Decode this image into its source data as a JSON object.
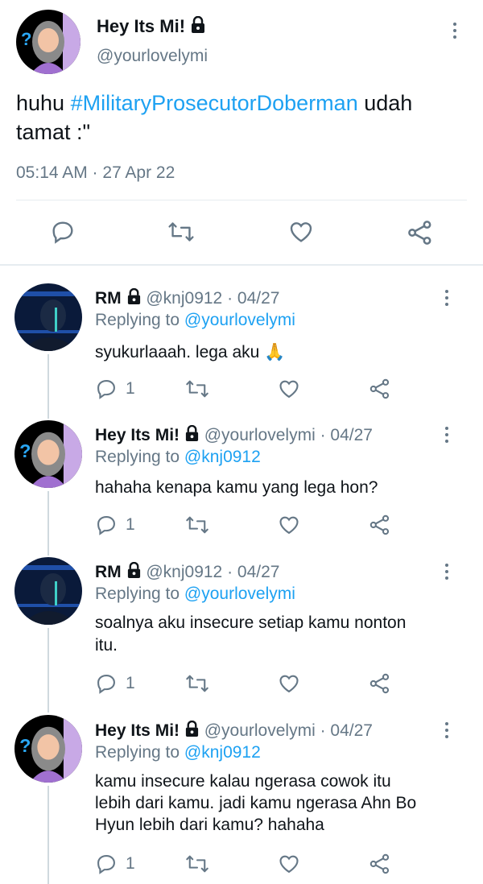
{
  "main_tweet": {
    "author_name": "Hey Its Mi!",
    "handle": "@yourlovelymi",
    "text_before": "huhu ",
    "hashtag": "#MilitaryProsecutorDoberman",
    "text_after_line1": " udah",
    "text_line2": "tamat :\"",
    "timestamp": "05:14 AM · 27 Apr 22"
  },
  "replies": [
    {
      "author_name": "RM",
      "handle": "@knj0912 · 04/27",
      "replying_label": "Replying to ",
      "replying_to": "@yourlovelymi",
      "text_lines": [
        "syukurlaaah. lega aku 🙏"
      ],
      "reply_count": "1",
      "avatar": "rm"
    },
    {
      "author_name": "Hey Its Mi!",
      "handle": "@yourlovelymi · 04/27",
      "replying_label": "Replying to ",
      "replying_to": "@knj0912",
      "text_lines": [
        "hahaha kenapa kamu yang lega hon?"
      ],
      "reply_count": "1",
      "avatar": "mi"
    },
    {
      "author_name": "RM",
      "handle": "@knj0912 · 04/27",
      "replying_label": "Replying to ",
      "replying_to": "@yourlovelymi",
      "text_lines": [
        "soalnya aku insecure setiap kamu nonton",
        "itu."
      ],
      "reply_count": "1",
      "avatar": "rm"
    },
    {
      "author_name": "Hey Its Mi!",
      "handle": "@yourlovelymi · 04/27",
      "replying_label": "Replying to ",
      "replying_to": "@knj0912",
      "text_lines": [
        "kamu insecure kalau ngerasa cowok itu",
        "lebih dari kamu. jadi kamu ngerasa Ahn Bo",
        "Hyun lebih dari kamu? hahaha"
      ],
      "reply_count": "1",
      "avatar": "mi"
    }
  ],
  "colors": {
    "link": "#1da1f2",
    "secondary": "#657786",
    "divider": "#e6ecf0"
  }
}
